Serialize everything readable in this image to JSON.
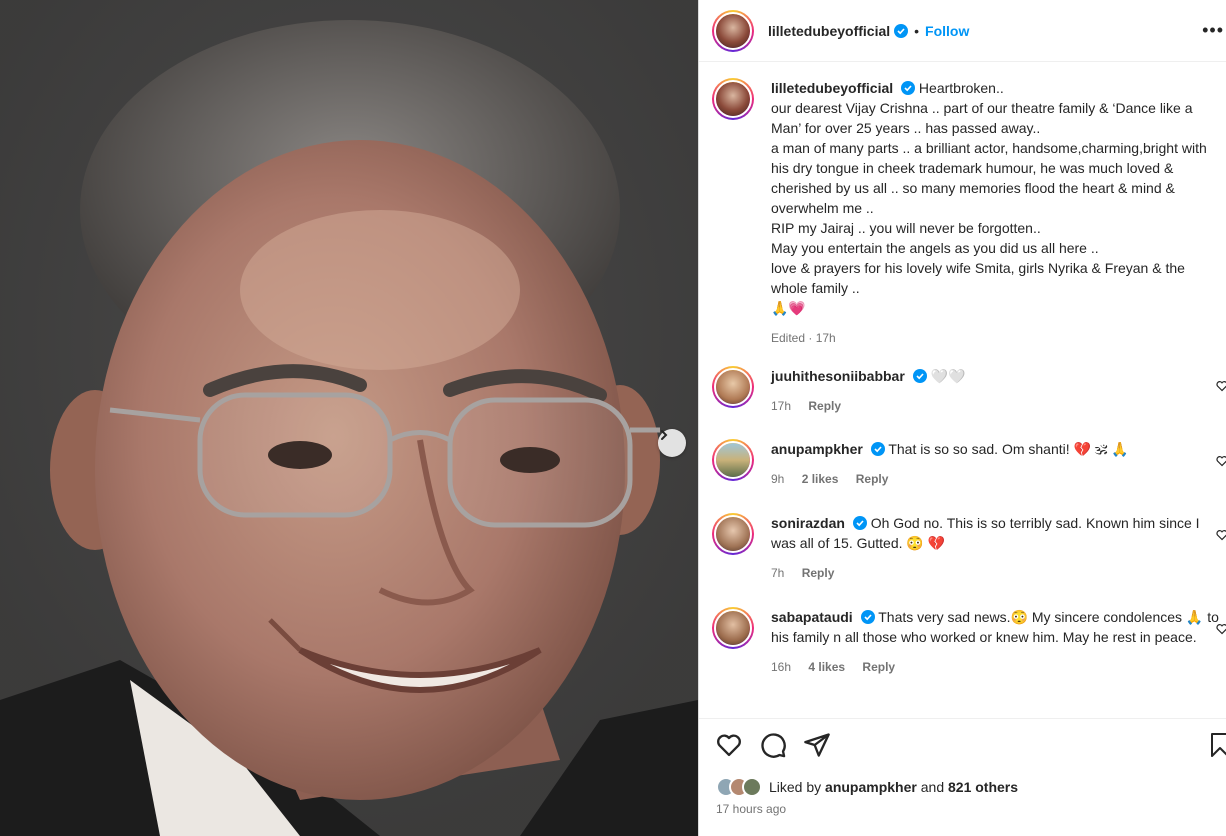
{
  "post": {
    "author": "lilletedubeyofficial",
    "follow_label": "Follow",
    "dot": "•",
    "more": "•••"
  },
  "caption": {
    "username": "lilletedubeyofficial",
    "text": "Heartbroken..\nour dearest Vijay Crishna .. part of our theatre family & ‘Dance like a Man’ for over 25 years .. has passed away..\na man of many parts .. a brilliant actor, handsome,charming,bright with his dry tongue in cheek trademark humour, he was much loved & cherished by us all .. so many memories flood the heart & mind & overwhelm me ..\nRIP my Jairaj .. you will never be forgotten..\nMay you entertain the angels as you did us all here ..\nlove & prayers for his lovely wife Smita, girls Nyrika & Freyan & the whole family ..\n🙏💗",
    "edited": "Edited · 17h"
  },
  "comments": [
    {
      "username": "juuhithesoniibabbar",
      "text": "🤍🤍",
      "time": "17h",
      "likes": "",
      "reply": "Reply"
    },
    {
      "username": "anupampkher",
      "text": "That is so so sad. Om shanti! 💔 🕉 🙏",
      "time": "9h",
      "likes": "2 likes",
      "reply": "Reply"
    },
    {
      "username": "sonirazdan",
      "text": "Oh God no. This is so terribly sad. Known him since I was all of 15. Gutted. 😳 💔",
      "time": "7h",
      "likes": "",
      "reply": "Reply"
    },
    {
      "username": "sabapataudi",
      "text": "Thats very sad news.😳 My sincere condolences 🙏 to his family n all those who worked or knew him. May he rest in peace.",
      "time": "16h",
      "likes": "4 likes",
      "reply": "Reply"
    }
  ],
  "likes": {
    "prefix": "Liked by",
    "user": "anupampkher",
    "and": "and",
    "others": "821 others"
  },
  "timestamp": "17 hours ago",
  "colors": {
    "link": "#0095f6",
    "text": "#262626",
    "muted": "#737373",
    "verified": "#0095f6"
  }
}
